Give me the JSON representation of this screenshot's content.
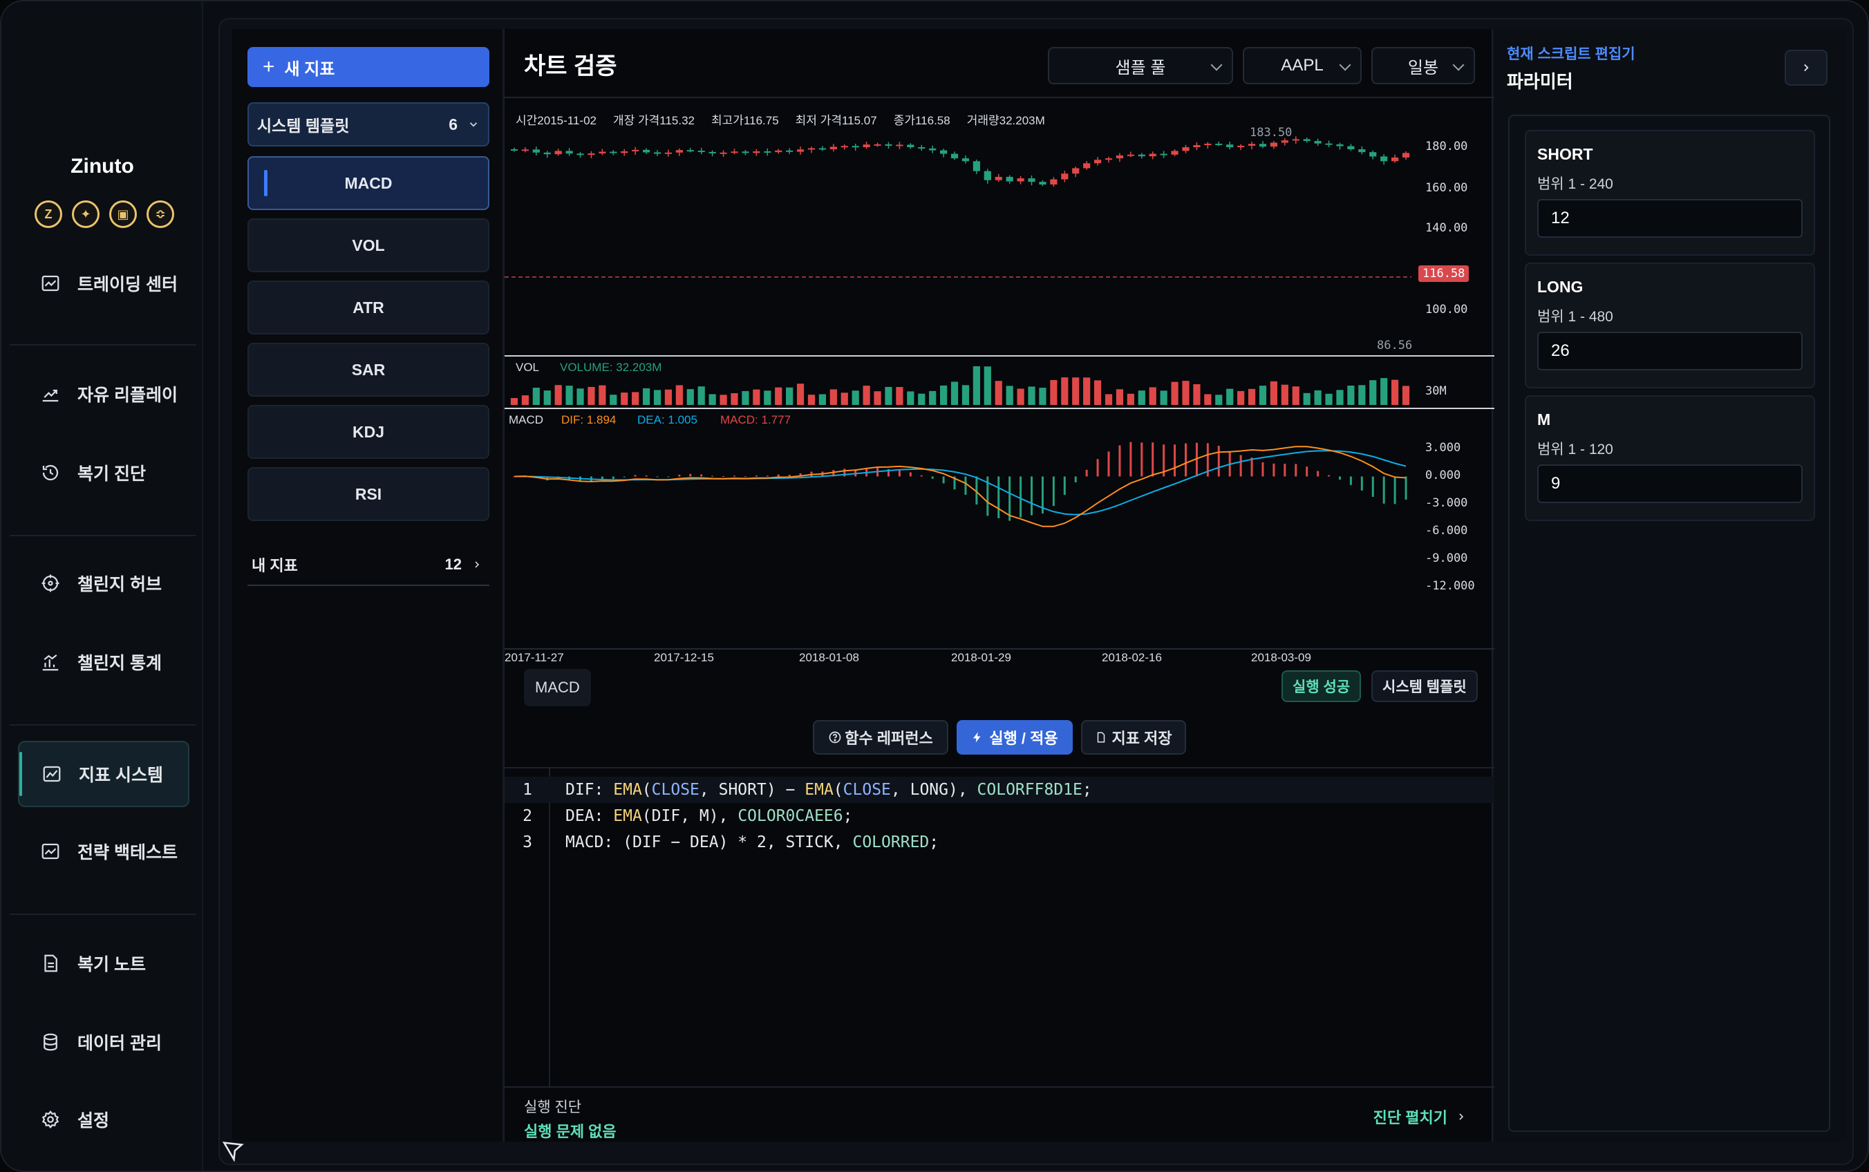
{
  "app": {
    "name": "Zinuto"
  },
  "sidebar": {
    "items": [
      {
        "label": "트레이딩 센터",
        "icon": "trading-icon"
      },
      {
        "label": "자유 리플레이",
        "icon": "trend-icon"
      },
      {
        "label": "복기 진단",
        "icon": "history-icon"
      },
      {
        "label": "챌린지 허브",
        "icon": "target-icon"
      },
      {
        "label": "챌린지 통계",
        "icon": "stats-icon"
      },
      {
        "label": "지표 시스템",
        "icon": "indicator-icon",
        "active": true
      },
      {
        "label": "전략 백테스트",
        "icon": "backtest-icon"
      },
      {
        "label": "복기 노트",
        "icon": "note-icon"
      },
      {
        "label": "데이터 관리",
        "icon": "database-icon"
      },
      {
        "label": "설정",
        "icon": "gear-icon"
      }
    ]
  },
  "indicators": {
    "new_label": "새 지표",
    "template_label": "시스템 템플릿",
    "template_count": "6",
    "items": [
      "MACD",
      "VOL",
      "ATR",
      "SAR",
      "KDJ",
      "RSI"
    ],
    "selected": "MACD",
    "my_label": "내 지표",
    "my_count": "12"
  },
  "main": {
    "title": "차트 검증",
    "pool_select": "샘플 풀",
    "symbol_select": "AAPL",
    "period_select": "일봉"
  },
  "ohlc": {
    "time": "시간2015-11-02",
    "open": "개장 가격115.32",
    "high": "최고가116.75",
    "low": "최저 가격115.07",
    "close": "종가116.58",
    "volume": "거래량32.203M"
  },
  "chart_data": {
    "type": "candlestick",
    "price_axis": [
      "180.00",
      "160.00",
      "140.00",
      "100.00"
    ],
    "last_price": "116.58",
    "max_label": "183.50",
    "min_label": "86.56",
    "ylim": [
      80,
      190
    ],
    "x_labels": [
      "2017-11-27",
      "2017-12-15",
      "2018-01-08",
      "2018-01-29",
      "2018-02-16",
      "2018-03-09"
    ],
    "close_series": [
      178.2,
      178.5,
      177.0,
      176.2,
      177.8,
      176.5,
      175.9,
      176.6,
      177.4,
      176.8,
      177.6,
      178.3,
      177.1,
      176.4,
      177.0,
      178.2,
      177.9,
      177.3,
      176.6,
      177.0,
      177.5,
      176.8,
      177.6,
      177.2,
      178.0,
      177.4,
      178.5,
      179.1,
      178.6,
      179.8,
      180.2,
      179.6,
      180.9,
      181.0,
      180.3,
      180.8,
      179.6,
      179.0,
      178.1,
      176.4,
      174.2,
      172.8,
      168.0,
      163.6,
      165.2,
      163.0,
      164.5,
      162.8,
      161.5,
      164.0,
      166.8,
      169.4,
      171.8,
      173.5,
      174.2,
      175.6,
      176.0,
      175.2,
      176.4,
      176.0,
      177.8,
      179.6,
      180.6,
      181.3,
      180.9,
      179.6,
      180.3,
      181.2,
      179.9,
      181.8,
      182.9,
      183.5,
      182.6,
      181.4,
      181.0,
      180.1,
      178.6,
      177.2,
      175.1,
      172.8,
      174.6,
      176.8
    ],
    "vol_label": "VOL",
    "volume_series_label": "VOLUME: 32.203M",
    "vol_axis": "30M",
    "macd_label": "MACD",
    "dif_label": "DIF: 1.894",
    "dea_label": "DEA: 1.005",
    "macd_value_label": "MACD: 1.777",
    "macd_axis": [
      "3.000",
      "0.000",
      "-3.000",
      "-6.000",
      "-9.000",
      "-12.000"
    ],
    "macd_ylim": [
      -13.5,
      4.5
    ],
    "colors": {
      "up": "#e04848",
      "down": "#26a17e",
      "dif": "#ff8d1e",
      "dea": "#0caee6",
      "macd": "#e04848"
    }
  },
  "editor": {
    "tab_label": "MACD",
    "status_pill": "실행 성공",
    "template_pill": "시스템 템플릿",
    "ref_button": "함수 레퍼런스",
    "run_button": "실행 / 적용",
    "save_button": "지표 저장",
    "lines": [
      {
        "n": "1",
        "code": "DIF: EMA(CLOSE, SHORT) − EMA(CLOSE, LONG), COLORFF8D1E;"
      },
      {
        "n": "2",
        "code": "DEA: EMA(DIF, M), COLOR0CAEE6;"
      },
      {
        "n": "3",
        "code": "MACD: (DIF − DEA) * 2, STICK, COLORRED;"
      }
    ],
    "diag_title": "실행 진단",
    "diag_status": "실행 문제 없음",
    "diag_expand": "진단 펼치기"
  },
  "params": {
    "editor_link": "현재 스크립트 편집기",
    "title": "파라미터",
    "items": [
      {
        "name": "SHORT",
        "range": "범위 1 - 240",
        "value": "12"
      },
      {
        "name": "LONG",
        "range": "범위 1 - 480",
        "value": "26"
      },
      {
        "name": "M",
        "range": "범위 1 - 120",
        "value": "9"
      }
    ]
  }
}
